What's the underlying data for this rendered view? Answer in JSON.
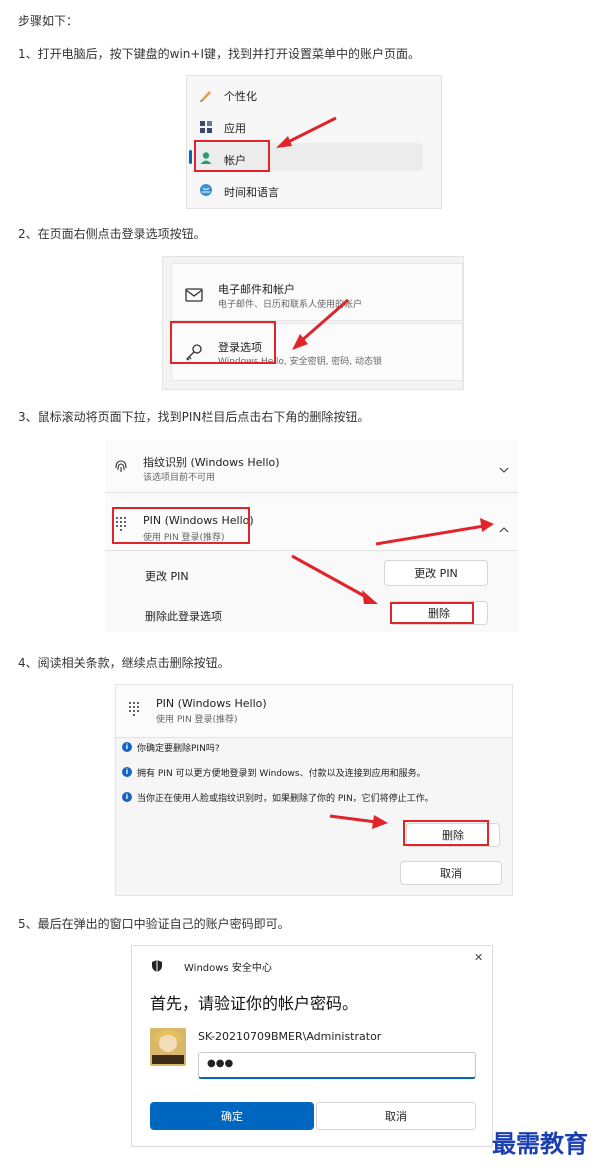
{
  "intro": "步骤如下：",
  "steps": [
    "1、打开电脑后，按下键盘的win+I键，找到并打开设置菜单中的账户页面。",
    "2、在页面右侧点击登录选项按钮。",
    "3、鼠标滚动将页面下拉，找到PIN栏目后点击右下角的删除按钮。",
    "4、阅读相关条款，继续点击删除按钮。",
    "5、最后在弹出的窗口中验证自己的账户密码即可。"
  ],
  "shot1": {
    "items": [
      "个性化",
      "应用",
      "帐户",
      "时间和语言"
    ]
  },
  "shot2": {
    "email_title": "电子邮件和帐户",
    "email_sub": "电子邮件、日历和联系人使用的帐户",
    "signin_title": "登录选项",
    "signin_sub": "Windows Hello, 安全密钥, 密码, 动态锁"
  },
  "shot3": {
    "finger_title": "指纹识别 (Windows Hello)",
    "finger_sub": "该选项目前不可用",
    "pin_title": "PIN (Windows Hello)",
    "pin_sub": "使用 PIN 登录(推荐)",
    "change_label": "更改 PIN",
    "change_button": "更改 PIN",
    "remove_label": "删除此登录选项",
    "remove_button": "删除"
  },
  "shot4": {
    "pin_title": "PIN (Windows Hello)",
    "pin_sub": "使用 PIN 登录(推荐)",
    "question": "你确定要删除PIN吗?",
    "note1": "拥有 PIN 可以更方便地登录到 Windows、付款以及连接到应用和服务。",
    "note2": "当你正在使用人脸或指纹识别时，如果删除了你的 PIN，它们将停止工作。",
    "remove_button": "删除",
    "cancel_button": "取消"
  },
  "shot5": {
    "window_title": "Windows 安全中心",
    "heading": "首先，请验证你的帐户密码。",
    "account": "SK-20210709BMER\\Administrator",
    "password_mask": "●●●",
    "ok_button": "确定",
    "cancel_button": "取消",
    "close_glyph": "✕"
  },
  "watermark": "最需教育",
  "colors": {
    "highlight": "#e0242a",
    "accent": "#0067c0",
    "watermark": "#1a3fb0"
  }
}
